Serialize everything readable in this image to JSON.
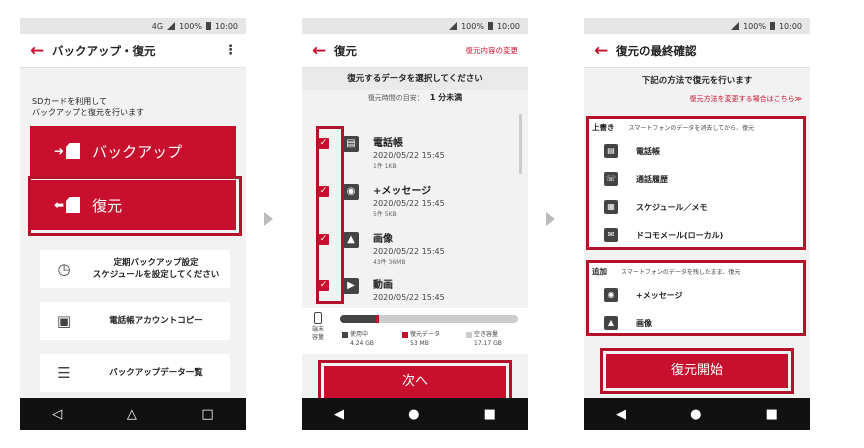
{
  "status": {
    "signal": "4G",
    "battery": "100%",
    "time": "10:00"
  },
  "screen1": {
    "title": "バックアップ・復元",
    "desc_line1": "SDカードを利用して",
    "desc_line2": "バックアップと復元を行います",
    "backup_label": "バックアップ",
    "restore_label": "復元",
    "menu": [
      {
        "line1": "定期バックアップ設定",
        "line2": "スケジュールを設定してください"
      },
      {
        "line1": "電話帳アカウントコピー",
        "line2": ""
      },
      {
        "line1": "バックアップデータ一覧",
        "line2": ""
      }
    ]
  },
  "screen2": {
    "title": "復元",
    "action": "復元内容の変更",
    "subtitle": "復元するデータを選択してください",
    "time_label": "復元時間の目安：",
    "time_value": "1 分未満",
    "items": [
      {
        "name": "電話帳",
        "date": "2020/05/22 15:45",
        "info": "1件 1KB",
        "checked": true
      },
      {
        "name": "+メッセージ",
        "date": "2020/05/22 15:45",
        "info": "5件 5KB",
        "checked": true
      },
      {
        "name": "画像",
        "date": "2020/05/22 15:45",
        "info": "43件 36MB",
        "checked": true
      },
      {
        "name": "動画",
        "date": "2020/05/22 15:45",
        "info": "",
        "checked": true
      }
    ],
    "storage": {
      "device_label_1": "端末",
      "device_label_2": "容量",
      "used_label": "使用中",
      "used_value": "4.24 GB",
      "restore_label": "復元データ",
      "restore_value": "53 MB",
      "free_label": "空き容量",
      "free_value": "17.17 GB",
      "used_fraction": 0.2,
      "restore_fraction": 0.02
    },
    "next_label": "次へ"
  },
  "screen3": {
    "title": "復元の最終確認",
    "subtitle": "下記の方法で復元を行います",
    "link": "復元方法を変更する場合はこちら≫",
    "overwrite": {
      "heading": "上書き",
      "note": "スマートフォンのデータを消去してから、復元",
      "items": [
        "電話帳",
        "通話履歴",
        "スケジュール／メモ",
        "ドコモメール(ローカル)"
      ]
    },
    "append": {
      "heading": "追加",
      "note": "スマートフォンのデータを残したまま、復元",
      "items": [
        "+メッセージ",
        "画像"
      ]
    },
    "start_label": "復元開始"
  },
  "colors": {
    "accent": "#c8102e",
    "highlight": "#b3122b"
  }
}
